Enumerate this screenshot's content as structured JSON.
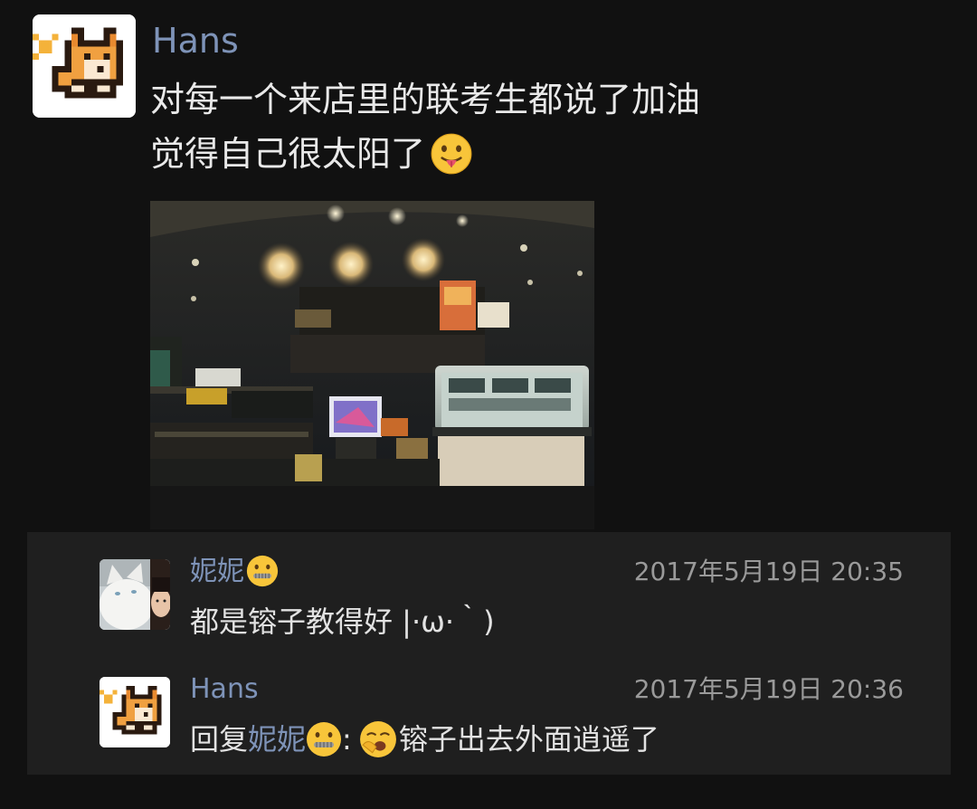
{
  "post": {
    "author": "Hans",
    "text_line1": "对每一个来店里的联考生都说了加油",
    "text_line2": "觉得自己很太阳了",
    "line2_emoji": "tongue-out-emoji",
    "avatar_icon": "shiba-pixel-avatar-icon"
  },
  "comments": [
    {
      "author": "妮妮",
      "author_emoji": "zipper-mouth-emoji",
      "timestamp": "2017年5月19日 20:35",
      "text": "都是镕子教得好 |·ω·｀)",
      "avatar_icon": "white-cat-avatar-icon"
    },
    {
      "author": "Hans",
      "timestamp": "2017年5月19日 20:36",
      "reply_prefix": "回复",
      "reply_to": "妮妮",
      "reply_to_emoji": "zipper-mouth-emoji",
      "separator": ":",
      "text_emoji": "yawning-emoji",
      "text": "镕子出去外面逍遥了",
      "avatar_icon": "shiba-pixel-avatar-icon"
    }
  ],
  "colors": {
    "background": "#111111",
    "comment_panel": "#1f1f1f",
    "name": "#7e93b8",
    "text": "#e9e9e9",
    "timestamp": "#9a9a9a"
  }
}
